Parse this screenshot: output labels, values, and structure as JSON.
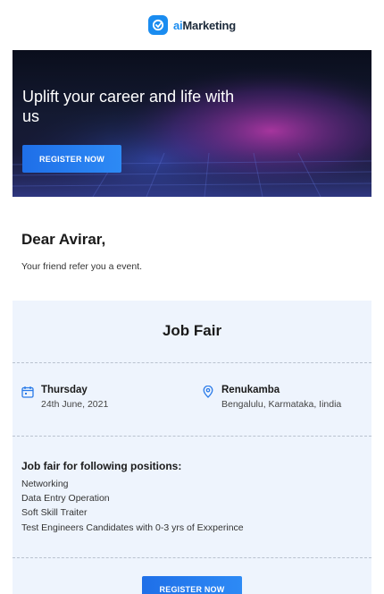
{
  "brand": {
    "prefix": "ai",
    "name": "Marketing",
    "color": "#1a8cf0"
  },
  "hero": {
    "title": "Uplift your career and life with us",
    "button_label": "REGISTER NOW"
  },
  "greeting": "Dear Avirar,",
  "intro": "Your friend refer you a event.",
  "event": {
    "title": "Job Fair",
    "day": "Thursday",
    "date": "24th June, 2021",
    "venue": "Renukamba",
    "address": "Bengalulu, Karmataka, Iindia",
    "date_icon": "calendar-icon",
    "location_icon": "location-pin-icon",
    "positions_heading": "Job fair for following positions:",
    "positions": [
      "Networking",
      "Data Entry Operation",
      "Soft Skill Traiter",
      "Test Engineers Candidates with 0-3 yrs of Exxperince"
    ],
    "button_label": "REGISTER NOW"
  },
  "colors": {
    "accent": "#1f6fe8",
    "card_bg": "#eef4fd"
  }
}
